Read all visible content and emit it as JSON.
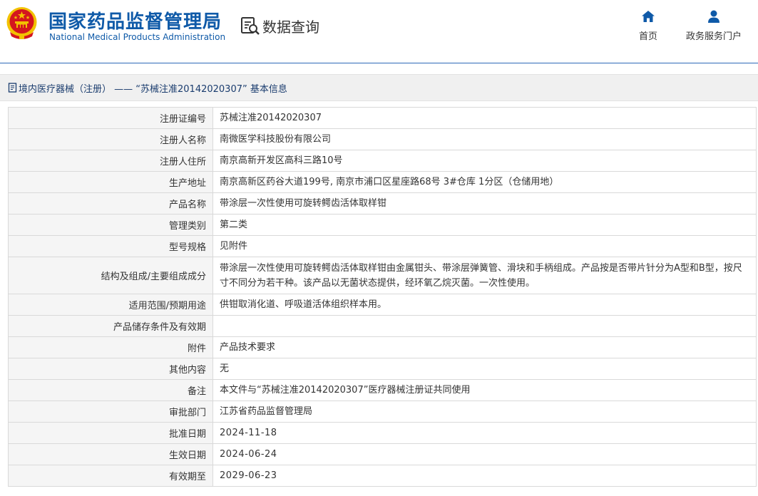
{
  "header": {
    "title_cn": "国家药品监督管理局",
    "title_en": "National Medical Products Administration",
    "query_label": "数据查询",
    "nav": [
      {
        "label": "首页",
        "icon": "home-icon"
      },
      {
        "label": "政务服务门户",
        "icon": "user-icon"
      }
    ]
  },
  "breadcrumb": {
    "text": "境内医疗器械（注册） —— “苏械注准20142020307” 基本信息"
  },
  "rows": [
    {
      "label": "注册证编号",
      "value": "苏械注准20142020307"
    },
    {
      "label": "注册人名称",
      "value": "南微医学科技股份有限公司"
    },
    {
      "label": "注册人住所",
      "value": "南京高新开发区高科三路10号"
    },
    {
      "label": "生产地址",
      "value": "南京高新区药谷大道199号, 南京市浦口区星座路68号 3#仓库 1分区（仓储用地）"
    },
    {
      "label": "产品名称",
      "value": "带涂层一次性使用可旋转鳄齿活体取样钳"
    },
    {
      "label": "管理类别",
      "value": "第二类"
    },
    {
      "label": "型号规格",
      "value": "见附件"
    },
    {
      "label": "结构及组成/主要组成成分",
      "value": "带涂层一次性使用可旋转鳄齿活体取样钳由金属钳头、带涂层弹簧管、滑块和手柄组成。产品按是否带片针分为A型和B型，按尺寸不同分为若干种。该产品以无菌状态提供，经环氧乙烷灭菌。一次性使用。"
    },
    {
      "label": "适用范围/预期用途",
      "value": "供钳取消化道、呼吸道活体组织样本用。"
    },
    {
      "label": "产品储存条件及有效期",
      "value": ""
    },
    {
      "label": "附件",
      "value": "产品技术要求"
    },
    {
      "label": "其他内容",
      "value": "无"
    },
    {
      "label": "备注",
      "value": "本文件与“苏械注准20142020307”医疗器械注册证共同使用"
    },
    {
      "label": "审批部门",
      "value": "江苏省药品监督管理局"
    },
    {
      "label": "批准日期",
      "value": "2024-11-18"
    },
    {
      "label": "生效日期",
      "value": "2024-06-24"
    },
    {
      "label": "有效期至",
      "value": "2029-06-23"
    }
  ],
  "colors": {
    "brand_blue": "#0f5aa8",
    "emblem_red": "#d4161e",
    "emblem_gold": "#f2c200"
  }
}
